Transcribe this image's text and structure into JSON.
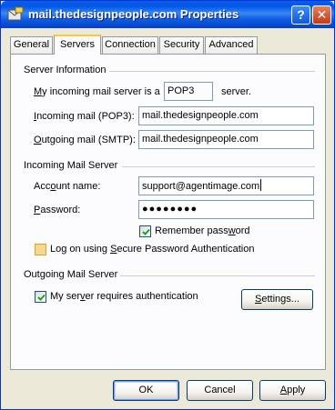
{
  "window": {
    "title": "mail.thedesignpeople.com Properties",
    "help_label": "?",
    "close_label": "✕"
  },
  "tabs": [
    {
      "label": "General",
      "active": false
    },
    {
      "label": "Servers",
      "active": true
    },
    {
      "label": "Connection",
      "active": false
    },
    {
      "label": "Security",
      "active": false
    },
    {
      "label": "Advanced",
      "active": false
    }
  ],
  "server_info": {
    "heading": "Server Information",
    "incoming_type_label_pre": "M",
    "incoming_type_label_post": "y incoming mail server is a",
    "incoming_type_value": "POP3",
    "incoming_type_suffix": "server.",
    "incoming_label_pre": "I",
    "incoming_label_post": "ncoming mail (POP3):",
    "incoming_value": "mail.thedesignpeople.com",
    "outgoing_label_pre": "O",
    "outgoing_label_post": "utgoing mail (SMTP):",
    "outgoing_value": "mail.thedesignpeople.com"
  },
  "incoming_server": {
    "heading": "Incoming Mail Server",
    "account_label_pre": "Acc",
    "account_label_u": "o",
    "account_label_post": "unt name:",
    "account_value": "support@agentimage.com",
    "password_label_pre": "P",
    "password_label_post": "assword:",
    "password_value": "●●●●●●●●",
    "remember_label_pre": "Remember pass",
    "remember_label_u": "w",
    "remember_label_post": "ord",
    "remember_checked": true,
    "spa_label_pre": "Log on using ",
    "spa_label_u": "S",
    "spa_label_post": "ecure Password Authentication",
    "spa_checked": false
  },
  "outgoing_server": {
    "heading": "Outgoing Mail Server",
    "auth_label_pre": "My ser",
    "auth_label_u": "v",
    "auth_label_post": "er requires authentication",
    "auth_checked": true,
    "settings_pre": "S",
    "settings_post": "ettings..."
  },
  "buttons": {
    "ok": "OK",
    "cancel": "Cancel",
    "apply_u": "A",
    "apply_post": "pply"
  },
  "colors": {
    "titlebar": "#0a5ee6",
    "check_green": "#21a121",
    "tab_highlight": "#ffc83c"
  }
}
